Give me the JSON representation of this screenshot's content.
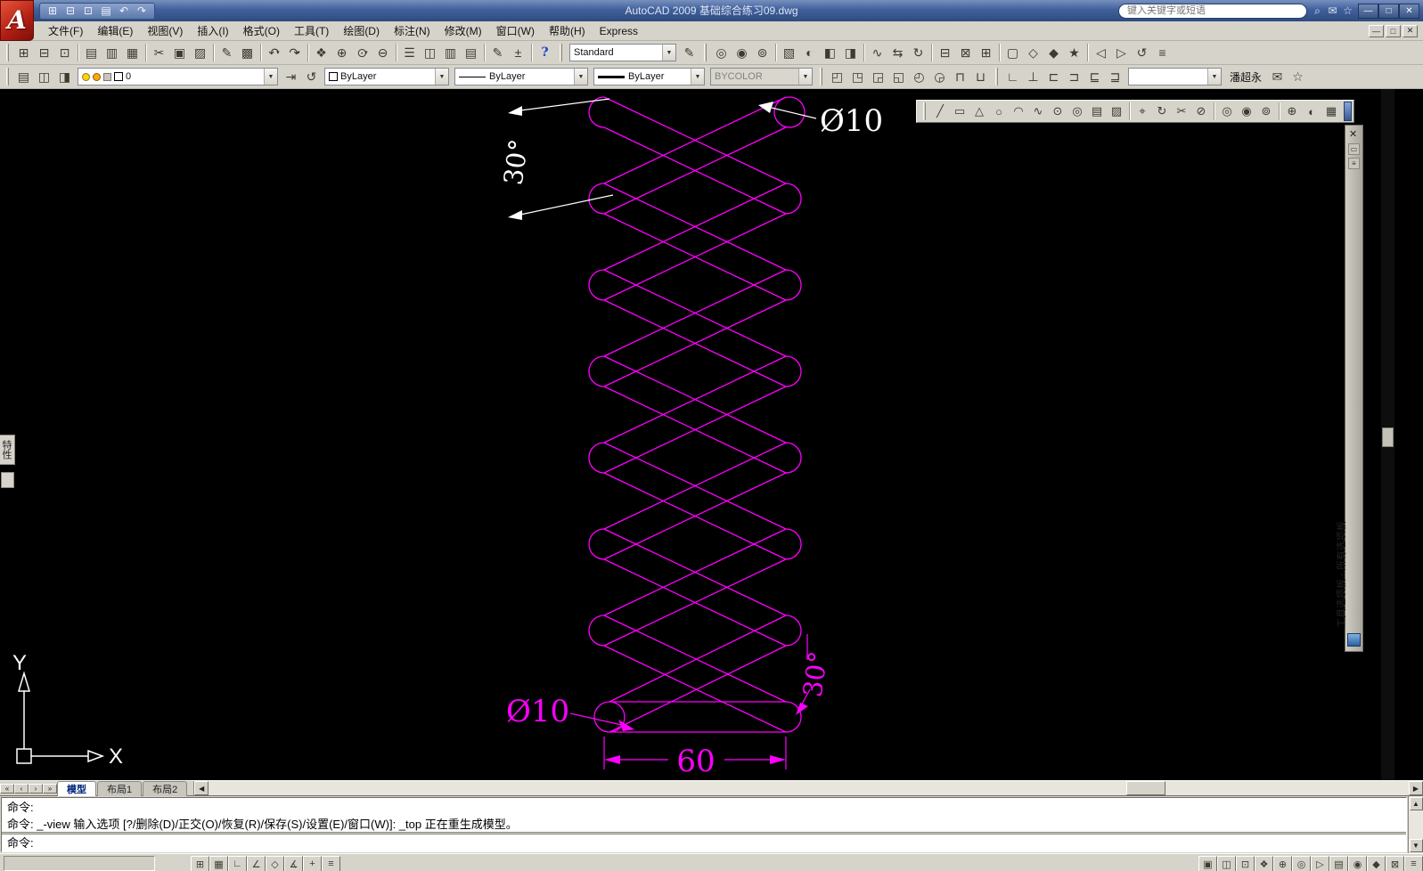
{
  "titlebar": {
    "title": "AutoCAD 2009 基础综合练习09.dwg",
    "search_placeholder": "键入关键字或短语",
    "qat_icons": [
      [
        "qnew-icon",
        "⊞"
      ],
      [
        "open-icon",
        "⊟"
      ],
      [
        "save-icon",
        "⊡"
      ],
      [
        "plot-icon",
        "▤"
      ],
      [
        "undo-icon",
        "↶"
      ],
      [
        "redo-icon",
        "↷"
      ]
    ],
    "search_icons": [
      [
        "search-icon",
        "⌕"
      ],
      [
        "comm-center-icon",
        "✉"
      ],
      [
        "favorites-icon",
        "☆"
      ]
    ],
    "window_buttons": [
      [
        "minimize-button",
        "—"
      ],
      [
        "maximize-button",
        "□"
      ],
      [
        "close-button",
        "✕"
      ]
    ]
  },
  "menubar": {
    "menus": [
      [
        "menu-file",
        "文件(F)"
      ],
      [
        "menu-edit",
        "编辑(E)"
      ],
      [
        "menu-view",
        "视图(V)"
      ],
      [
        "menu-insert",
        "插入(I)"
      ],
      [
        "menu-format",
        "格式(O)"
      ],
      [
        "menu-tools",
        "工具(T)"
      ],
      [
        "menu-draw",
        "绘图(D)"
      ],
      [
        "menu-dimension",
        "标注(N)"
      ],
      [
        "menu-modify",
        "修改(M)"
      ],
      [
        "menu-window",
        "窗口(W)"
      ],
      [
        "menu-help",
        "帮助(H)"
      ],
      [
        "menu-express",
        "Express"
      ]
    ],
    "mdi_buttons": [
      [
        "mdi-minimize-button",
        "—"
      ],
      [
        "mdi-restore-button",
        "□"
      ],
      [
        "mdi-close-button",
        "✕"
      ]
    ]
  },
  "toolbars": {
    "style_name": "Standard",
    "layer_name": "0",
    "color": "ByLayer",
    "linetype": "ByLayer",
    "lineweight": "ByLayer",
    "plot_style": "BYCOLOR",
    "user": "潘超永",
    "row1a": [
      [
        "qnew-icon",
        "⊞"
      ],
      [
        "open-icon",
        "⊟"
      ],
      [
        "save-icon",
        "⊡"
      ],
      "|",
      [
        "plot-icon",
        "▤"
      ],
      [
        "plot-preview-icon",
        "▥"
      ],
      [
        "publish-icon",
        "▦"
      ],
      "|",
      [
        "cut-icon",
        "✂"
      ],
      [
        "copy-icon",
        "▣"
      ],
      [
        "paste-icon",
        "▨"
      ],
      "|",
      [
        "match-properties-icon",
        "✎"
      ],
      [
        "block-editor-icon",
        "▩"
      ],
      "|",
      [
        "undo-icon",
        "↶",
        "dd"
      ],
      [
        "redo-icon",
        "↷",
        "dd"
      ],
      "|",
      [
        "pan-icon",
        "❖"
      ],
      [
        "zoom-realtime-icon",
        "⊕"
      ],
      [
        "zoom-window-icon",
        "⊙",
        "dd"
      ],
      [
        "zoom-previous-icon",
        "⊖"
      ],
      "|",
      [
        "properties-icon",
        "☰"
      ],
      [
        "designcenter-icon",
        "◫"
      ],
      [
        "tool-palettes-icon",
        "▥"
      ],
      [
        "sheetset-icon",
        "▤"
      ],
      "|",
      [
        "markup-icon",
        "✎"
      ],
      [
        "quickcalc-icon",
        "±"
      ],
      "|",
      [
        "help-icon",
        "?"
      ]
    ],
    "row1b": [
      [
        "named-views-icon",
        "◎"
      ],
      [
        "3d-views-icon",
        "◉"
      ],
      [
        "camera-icon",
        "⊚"
      ],
      "|",
      [
        "render-icon",
        "▧"
      ],
      [
        "lights-icon",
        "◐"
      ],
      [
        "materials-icon",
        "◧"
      ],
      [
        "mapping-icon",
        "◨"
      ],
      "|",
      [
        "motion-path-icon",
        "∿"
      ],
      [
        "walk-icon",
        "⇆"
      ],
      [
        "orbit-icon",
        "↻"
      ],
      "|",
      [
        "sheet-icon",
        "⊟"
      ],
      [
        "markup-set-icon",
        "⊠"
      ],
      [
        "etransmit-icon",
        "⊞"
      ],
      "|",
      [
        "clean-screen-icon",
        "▢"
      ],
      [
        "workspace-icon",
        "◇"
      ],
      [
        "lock-location-icon",
        "◆"
      ],
      [
        "express-tools-icon",
        "★"
      ],
      "|",
      [
        "view-back-icon",
        "◁"
      ],
      [
        "view-forward-icon",
        "▷"
      ],
      [
        "refresh-icon",
        "↺"
      ],
      [
        "info-icon",
        "≡"
      ]
    ],
    "row2a": [
      [
        "layer-properties-icon",
        "▤"
      ],
      [
        "layer-filter-icon",
        "◫"
      ],
      [
        "layer-states-icon",
        "◨"
      ]
    ],
    "row2b": [
      [
        "make-layer-current-icon",
        "⇥"
      ],
      [
        "layer-previous-icon",
        "↺"
      ]
    ],
    "row2c": [
      [
        "view-box-icon-1",
        "◰"
      ],
      [
        "view-box-icon-2",
        "◳"
      ],
      [
        "view-box-icon-3",
        "◲"
      ],
      [
        "view-box-icon-4",
        "◱"
      ],
      [
        "view-clock-icon-1",
        "◴"
      ],
      [
        "view-clock-icon-2",
        "◶"
      ],
      [
        "extrude-icon",
        "⊓"
      ],
      [
        "union-icon",
        "⊔"
      ]
    ],
    "row2d": [
      [
        "ucs-icon",
        "∟"
      ],
      [
        "ucs-world-icon",
        "⊥"
      ],
      [
        "viewport-icon-1",
        "⊏"
      ],
      [
        "viewport-icon-2",
        "⊐"
      ],
      [
        "viewport-icon-3",
        "⊑"
      ],
      [
        "viewport-icon-4",
        "⊒"
      ]
    ],
    "row2e": [
      [
        "comm-tray-icon",
        "✉"
      ],
      [
        "favorites-tray-icon",
        "☆"
      ]
    ]
  },
  "draw_toolbar": {
    "icons": [
      [
        "line-icon",
        "╱"
      ],
      [
        "rectangle-icon",
        "▭"
      ],
      [
        "polygon-icon",
        "△"
      ],
      [
        "circle-icon",
        "○"
      ],
      [
        "arc-icon",
        "◠"
      ],
      [
        "spline-icon",
        "∿"
      ],
      [
        "ellipse-icon",
        "⊙"
      ],
      [
        "donut-icon",
        "◎"
      ],
      [
        "hatch-icon",
        "▤"
      ],
      [
        "gradient-icon",
        "▨"
      ],
      "|",
      [
        "move-icon",
        "⌖"
      ],
      [
        "rotate-icon",
        "↻"
      ],
      [
        "trim-icon",
        "✂"
      ],
      [
        "erase-icon",
        "⊘"
      ],
      "|",
      [
        "ring-tool-icon-1",
        "◎"
      ],
      [
        "ring-tool-icon-2",
        "◉"
      ],
      [
        "ring-tool-icon-3",
        "⊚"
      ],
      "|",
      [
        "insert-block-icon",
        "⊕"
      ],
      [
        "region-icon",
        "◐"
      ],
      [
        "table-icon",
        "▦"
      ]
    ]
  },
  "tool_palette": {
    "title": "工具选项板 - 所有选项板",
    "close_glyph": "✕"
  },
  "properties_tab": {
    "label": "特性"
  },
  "drawing": {
    "dim_dia_top": "Ø10",
    "dim_angle_top": "30°",
    "dim_dia_bottom": "Ø10",
    "dim_angle_bottom": "30°",
    "dim_length": "60",
    "ucs_x": "X",
    "ucs_y": "Y",
    "spring_color": "#ff00ff",
    "dim_color_top": "#ffffff",
    "dim_color_bottom": "#ff00ff"
  },
  "layout_tabs": {
    "nav": [
      [
        "tab-first-button",
        "«"
      ],
      [
        "tab-prev-button",
        "‹"
      ],
      [
        "tab-next-button",
        "›"
      ],
      [
        "tab-last-button",
        "»"
      ]
    ],
    "tabs": [
      "模型",
      "布局1",
      "布局2"
    ],
    "active": "模型"
  },
  "command": {
    "history": [
      "命令:",
      "命令: _-view 输入选项 [?/删除(D)/正交(O)/恢复(R)/保存(S)/设置(E)/窗口(W)]: _top 正在重生成模型。"
    ],
    "prompt": "命令:"
  },
  "statusbar": {
    "left_buttons": [
      [
        "snap-icon",
        "⊞"
      ],
      [
        "grid-icon",
        "▦"
      ],
      [
        "ortho-icon",
        "∟"
      ],
      [
        "polar-icon",
        "∠"
      ],
      [
        "osnap-icon",
        "◇"
      ],
      [
        "otrack-icon",
        "∡"
      ],
      [
        "dyn-input-icon",
        "+"
      ],
      [
        "lineweight-toggle-icon",
        "≡"
      ]
    ],
    "right_buttons": [
      [
        "model-toggle-icon",
        "▣"
      ],
      [
        "quickview-layouts-icon",
        "◫"
      ],
      [
        "quickview-drawings-icon",
        "⊡"
      ],
      [
        "pan-status-icon",
        "❖"
      ],
      [
        "zoom-status-icon",
        "⊕"
      ],
      [
        "steeringwheel-icon",
        "◎"
      ],
      [
        "showmotion-icon",
        "▷"
      ],
      [
        "annotation-scale-icon",
        "▤"
      ],
      [
        "annotation-visibility-icon",
        "◉"
      ],
      [
        "autoscale-icon",
        "◆"
      ],
      [
        "toolbar-lock-icon",
        "⊠"
      ],
      [
        "tray-arrow-icon",
        "≡"
      ]
    ]
  }
}
